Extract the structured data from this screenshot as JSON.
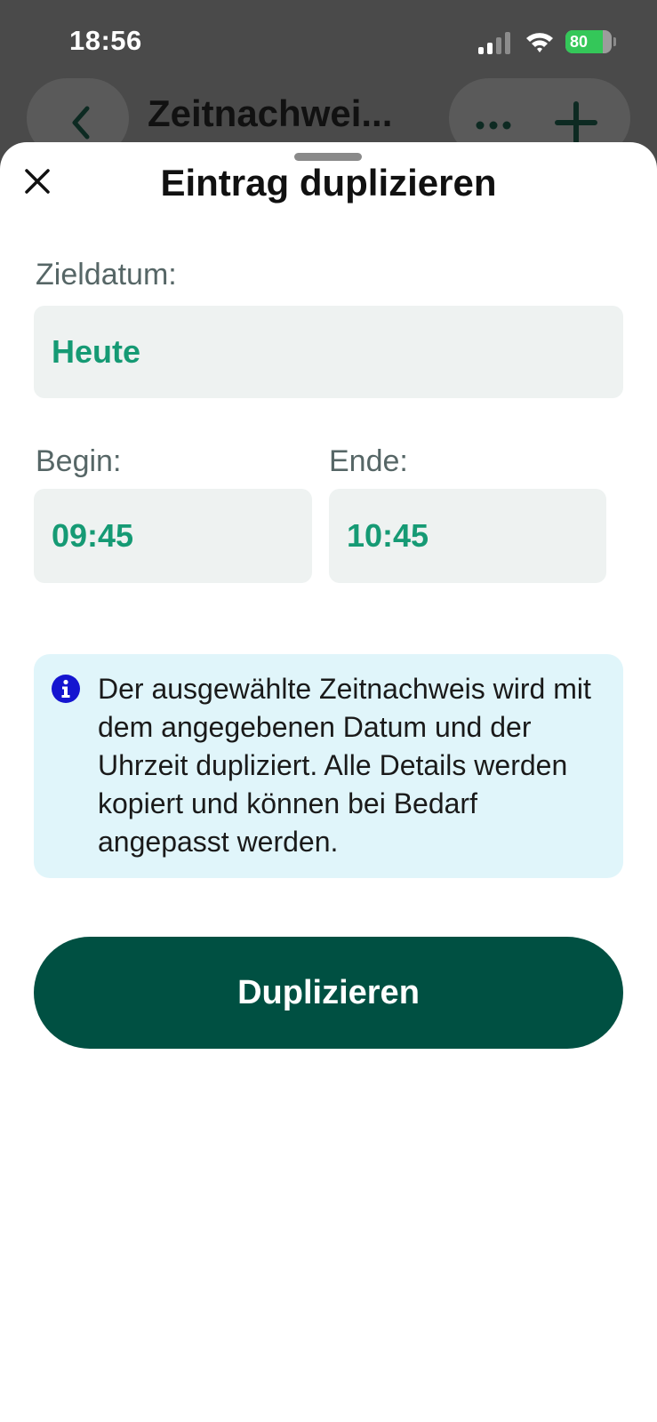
{
  "status_bar": {
    "time": "18:56",
    "battery_level": "80",
    "battery_fraction": 0.8
  },
  "nav": {
    "title": "Zeitnachwei..."
  },
  "sheet": {
    "title": "Eintrag duplizieren",
    "target_date": {
      "label": "Zieldatum:",
      "value": "Heute"
    },
    "begin": {
      "label": "Begin:",
      "value": "09:45"
    },
    "end": {
      "label": "Ende:",
      "value": "10:45"
    },
    "info": {
      "text": "Der ausgewählte Zeitnachweis wird mit dem angegebenen Datum und der Uhrzeit dupliziert. Alle Details werden kopiert und können bei Bedarf angepasst werden."
    },
    "primary_button": {
      "label": "Duplizieren"
    }
  },
  "colors": {
    "accent": "#159a74",
    "primary_button": "#005042",
    "info_background": "#e0f5fa",
    "info_icon": "#1515d0",
    "field_background": "#eef2f1"
  },
  "icons": [
    "signal-icon",
    "wifi-icon",
    "battery-icon",
    "back-chevron-icon",
    "more-icon",
    "plus-icon",
    "close-icon",
    "info-icon"
  ]
}
